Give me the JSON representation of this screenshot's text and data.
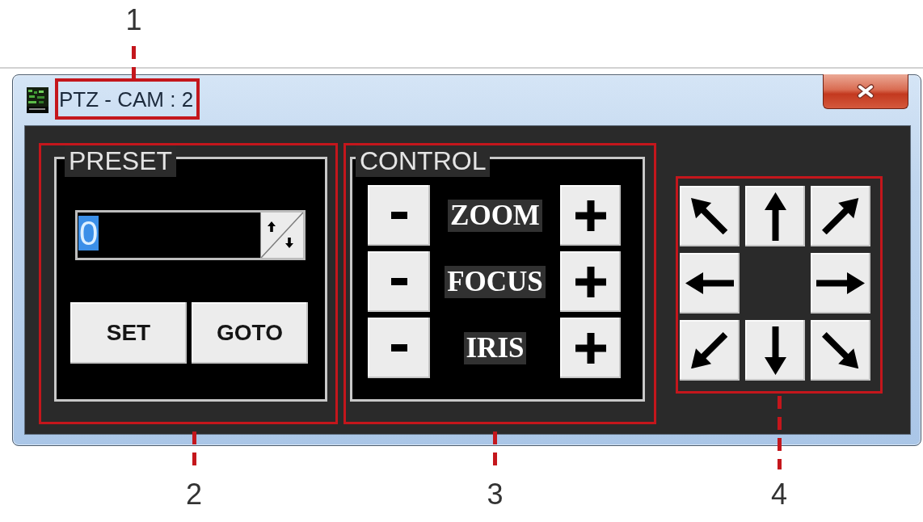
{
  "window": {
    "title": "PTZ - CAM : 2",
    "callout": "1"
  },
  "preset": {
    "legend": "PRESET",
    "value": "0",
    "value_highlighted": true,
    "buttons": [
      "SET",
      "GOTO"
    ],
    "callout": "2"
  },
  "control": {
    "legend": "CONTROL",
    "rows": [
      {
        "label": "ZOOM"
      },
      {
        "label": "FOCUS"
      },
      {
        "label": "IRIS"
      }
    ],
    "callout": "3"
  },
  "direction_pad": {
    "callout": "4"
  }
}
